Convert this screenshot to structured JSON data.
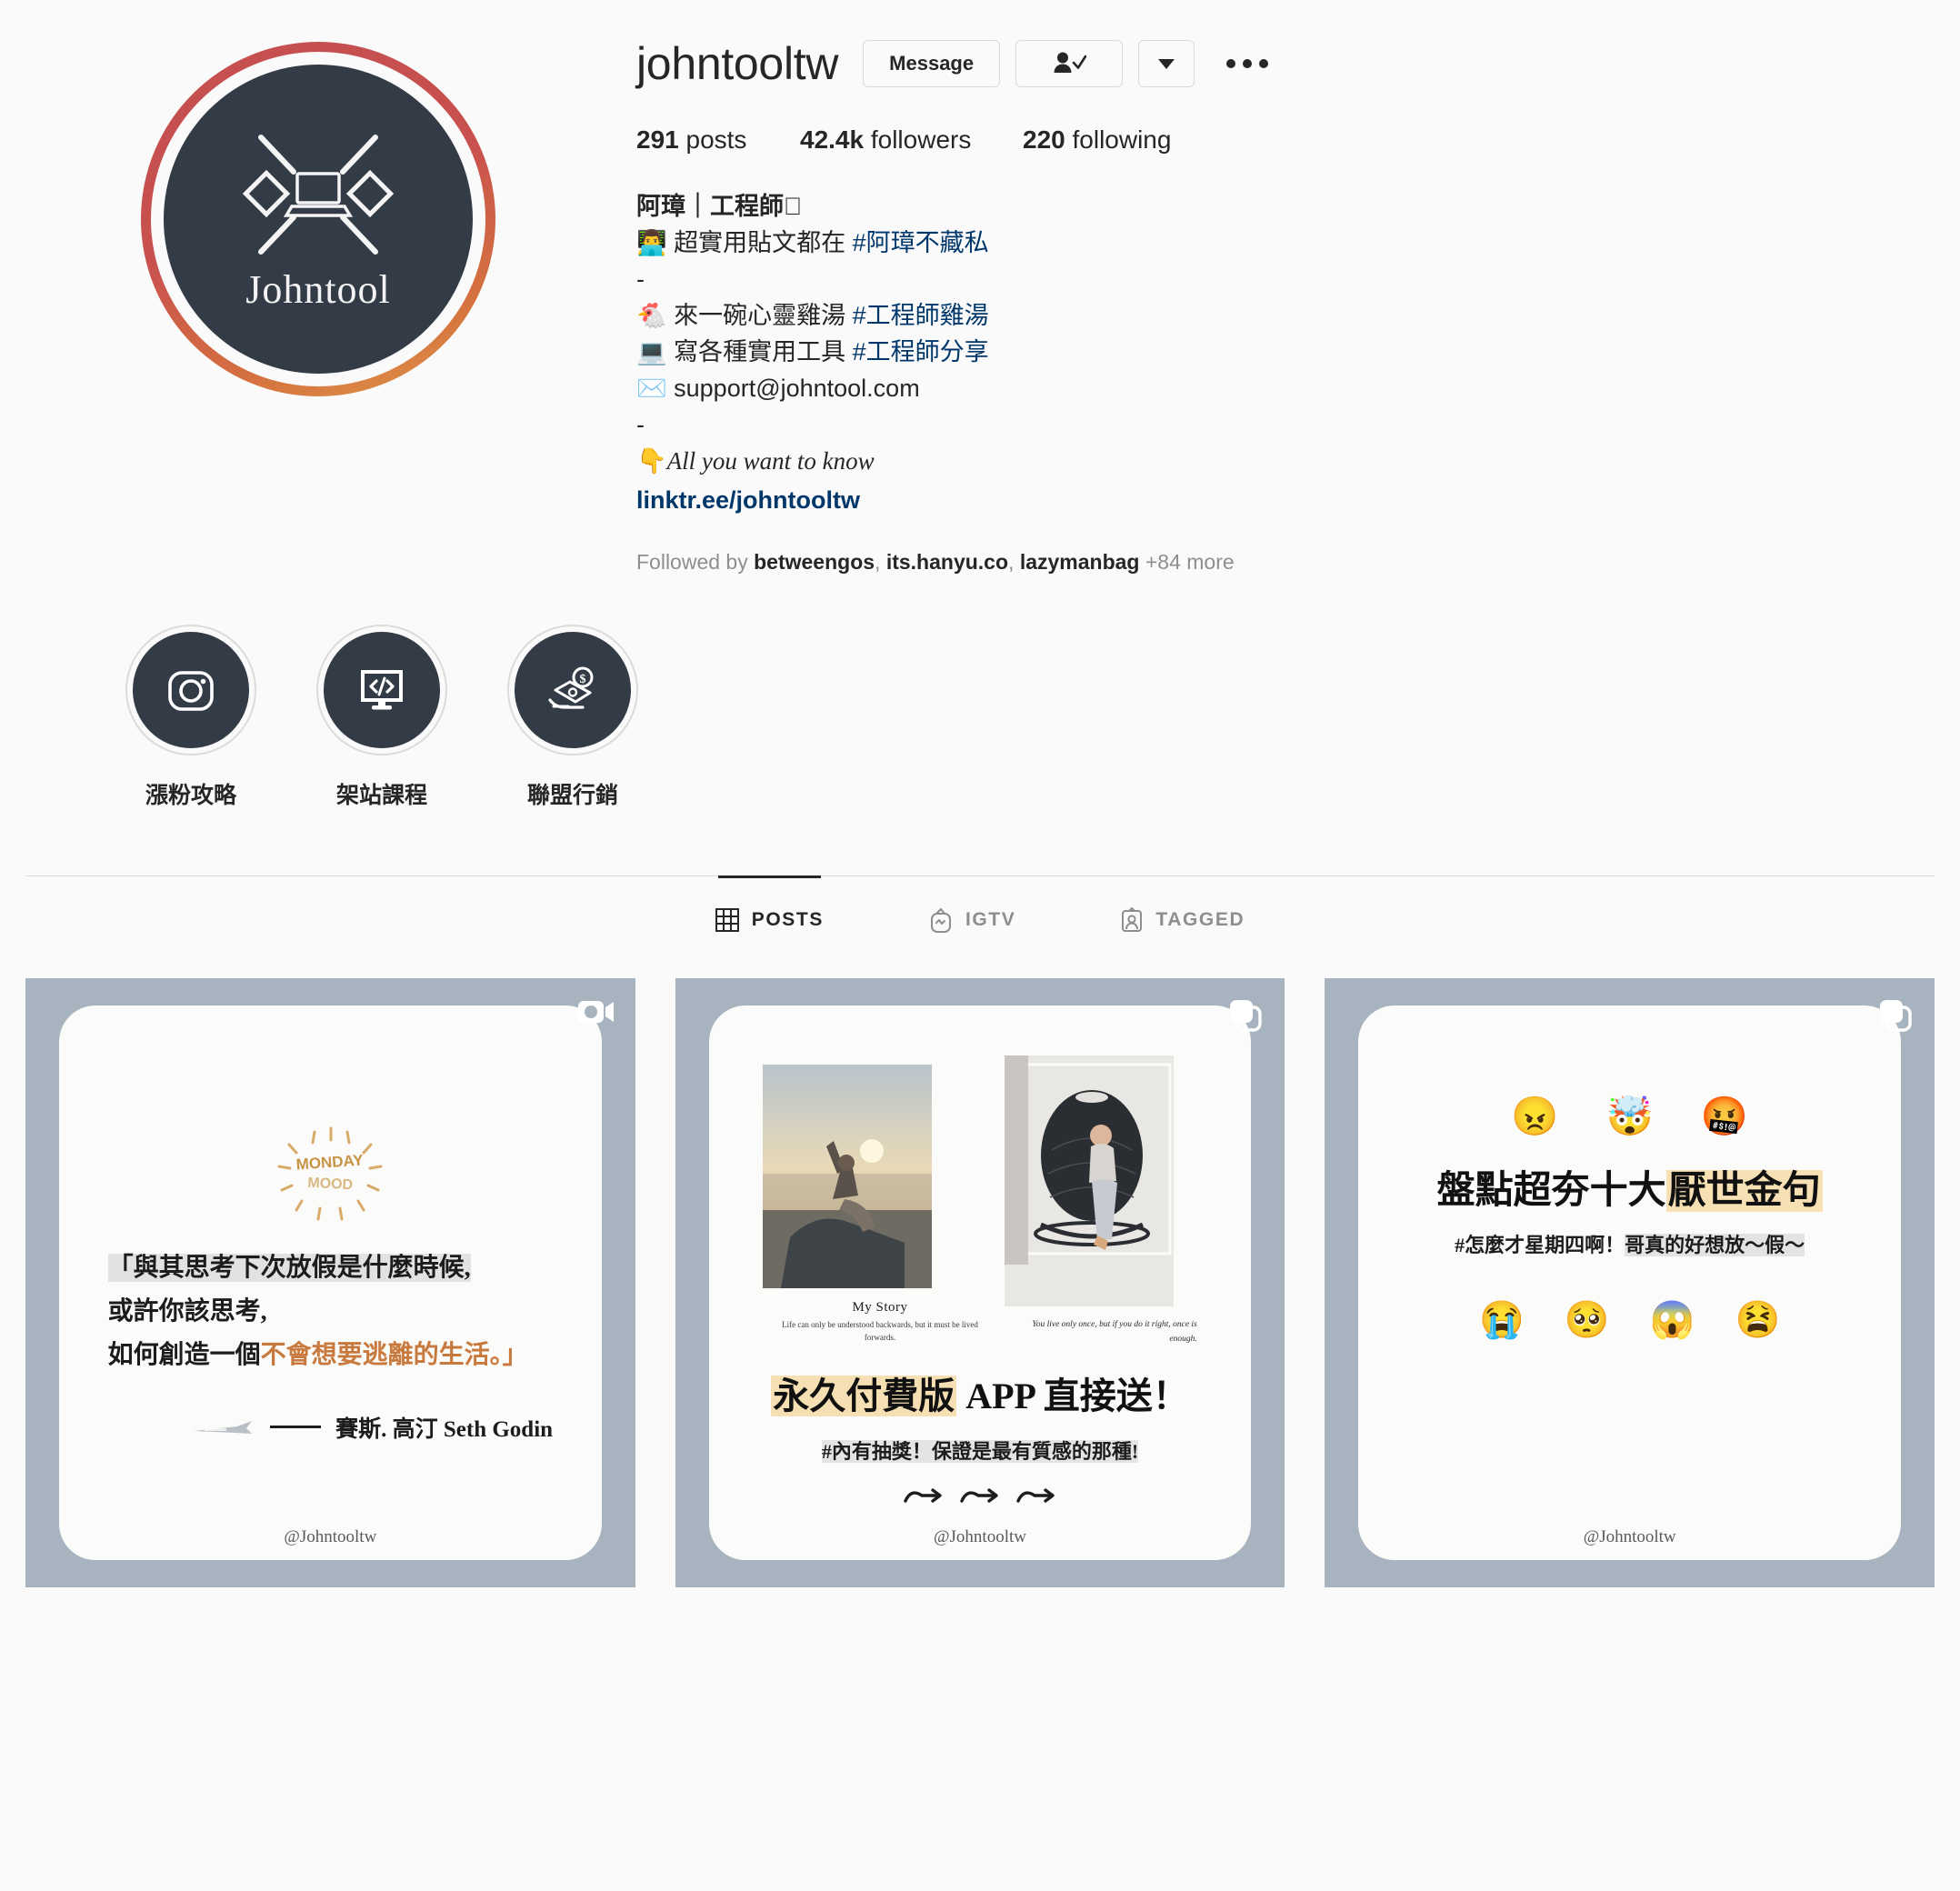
{
  "profile": {
    "username": "johntooltw",
    "avatar_name": "Johntool",
    "avatar_icon": "laptop-logo-icon",
    "buttons": {
      "message": "Message",
      "following_icon": "person-check-icon",
      "caret_icon": "chevron-down-icon",
      "more_icon": "ellipsis-icon"
    },
    "stats": [
      {
        "value": "291",
        "label": "posts"
      },
      {
        "value": "42.4k",
        "label": "followers"
      },
      {
        "value": "220",
        "label": "following"
      }
    ],
    "bio": {
      "title": "阿璋｜工程師",
      "title_emoji": "",
      "lines": [
        {
          "emoji": "👨‍💻",
          "text": "超實用貼文都在 ",
          "tag": "#阿璋不藏私"
        },
        {
          "emoji": "",
          "text": "-",
          "tag": ""
        },
        {
          "emoji": "🐔",
          "text": "來一碗心靈雞湯 ",
          "tag": "#工程師雞湯"
        },
        {
          "emoji": "💻",
          "text": "寫各種實用工具 ",
          "tag": "#工程師分享"
        },
        {
          "emoji": "✉️",
          "text": "support@johntool.com",
          "tag": ""
        },
        {
          "emoji": "",
          "text": "-",
          "tag": ""
        }
      ],
      "italic_emoji": "👇",
      "italic_text": "All you want to know",
      "link": "linktr.ee/johntooltw"
    },
    "followed_by": {
      "prefix": "Followed by ",
      "names": [
        "betweengos",
        "its.hanyu.co",
        "lazymanbag"
      ],
      "suffix": " +84 more"
    }
  },
  "highlights": [
    {
      "label": "漲粉攻略",
      "icon": "instagram-camera-icon"
    },
    {
      "label": "架站課程",
      "icon": "code-monitor-icon"
    },
    {
      "label": "聯盟行銷",
      "icon": "money-hand-icon"
    }
  ],
  "tabs": [
    {
      "label": "POSTS",
      "icon": "grid-icon",
      "active": true
    },
    {
      "label": "IGTV",
      "icon": "igtv-icon",
      "active": false
    },
    {
      "label": "TAGGED",
      "icon": "tagged-person-icon",
      "active": false
    }
  ],
  "posts": [
    {
      "type_icon": "video-camera-icon",
      "badge_label": "MONDAY MOOD",
      "quote_line1": "「與其思考下次放假是什麼時候,",
      "quote_line2": "或許你該思考,",
      "quote_line3_a": "如何創造一個",
      "quote_line3_b": "不會想要逃離的生活。」",
      "attribution": "賽斯. 高汀 Seth Godin",
      "watermark": "@Johntooltw"
    },
    {
      "type_icon": "carousel-icon",
      "photo1_caption": "My Story",
      "photo1_sub": "Life can only be understood backwards, but it must be lived forwards.",
      "photo2_sub": "You live only once, but if you do it right, once is enough.",
      "headline_highlight": "永久付費版",
      "headline_rest": " APP 直接送！",
      "subline": "#內有抽獎！保證是最有質感的那種!",
      "watermark": "@Johntooltw"
    },
    {
      "type_icon": "carousel-icon",
      "emoji_top": [
        "😠",
        "🤯",
        "🤬"
      ],
      "headline_a": "盤點超夯十大",
      "headline_b": "厭世金句",
      "subline_a": "#怎麼才星期四啊！",
      "subline_b": "哥真的好想放～假～",
      "emoji_bottom": [
        "😭",
        "🥺",
        "😱",
        "😫"
      ],
      "watermark": "@Johntooltw"
    }
  ],
  "colors": {
    "link": "#00376b",
    "muted": "#8e8e8e",
    "text": "#262626",
    "avatar_bg": "#333b47",
    "post_bg": "#a7b4bf"
  }
}
